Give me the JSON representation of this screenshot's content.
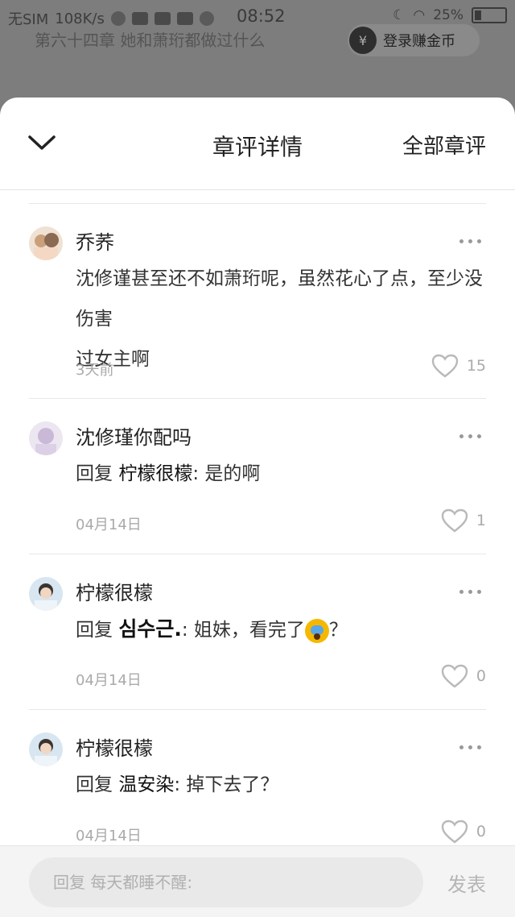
{
  "status_bar": {
    "carrier": "无SIM",
    "speed": "108K/s",
    "time": "08:52",
    "battery": "25%"
  },
  "background_page": {
    "chapter_title": "第六十四章 她和萧珩都做过什么",
    "coin_button_label": "登录赚金币",
    "coin_icon_glyph": "¥"
  },
  "sheet": {
    "title": "章评详情",
    "all_comments_label": "全部章评"
  },
  "comments": [
    {
      "username": "乔荞",
      "line1": "沈修谨甚至还不如萧珩呢，虽然花心了点，至少没伤害",
      "line2": "过女主啊",
      "date": "3天前",
      "likes": "15",
      "avatar_color": "#e8d6c6"
    },
    {
      "username": "沈修瑾你配吗",
      "reply_word": "回复",
      "reply_to": "柠檬很檬",
      "reply_text": ": 是的啊",
      "date": "04月14日",
      "likes": "1",
      "avatar_color": "#d9d2e2"
    },
    {
      "username": "柠檬很檬",
      "reply_word": "回复",
      "reply_to": "심수근.",
      "reply_text": ": 姐妹，看完了",
      "reply_tail": "？",
      "date": "04月14日",
      "likes": "0",
      "avatar_color": "#bcd2e4"
    },
    {
      "username": "柠檬很檬",
      "reply_word": "回复",
      "reply_to": "温安染",
      "reply_text": ": 掉下去了？",
      "date": "04月14日",
      "likes": "0",
      "avatar_color": "#bcd2e4"
    }
  ],
  "input_bar": {
    "placeholder": "回复 每天都睡不醒:",
    "send_label": "发表"
  }
}
